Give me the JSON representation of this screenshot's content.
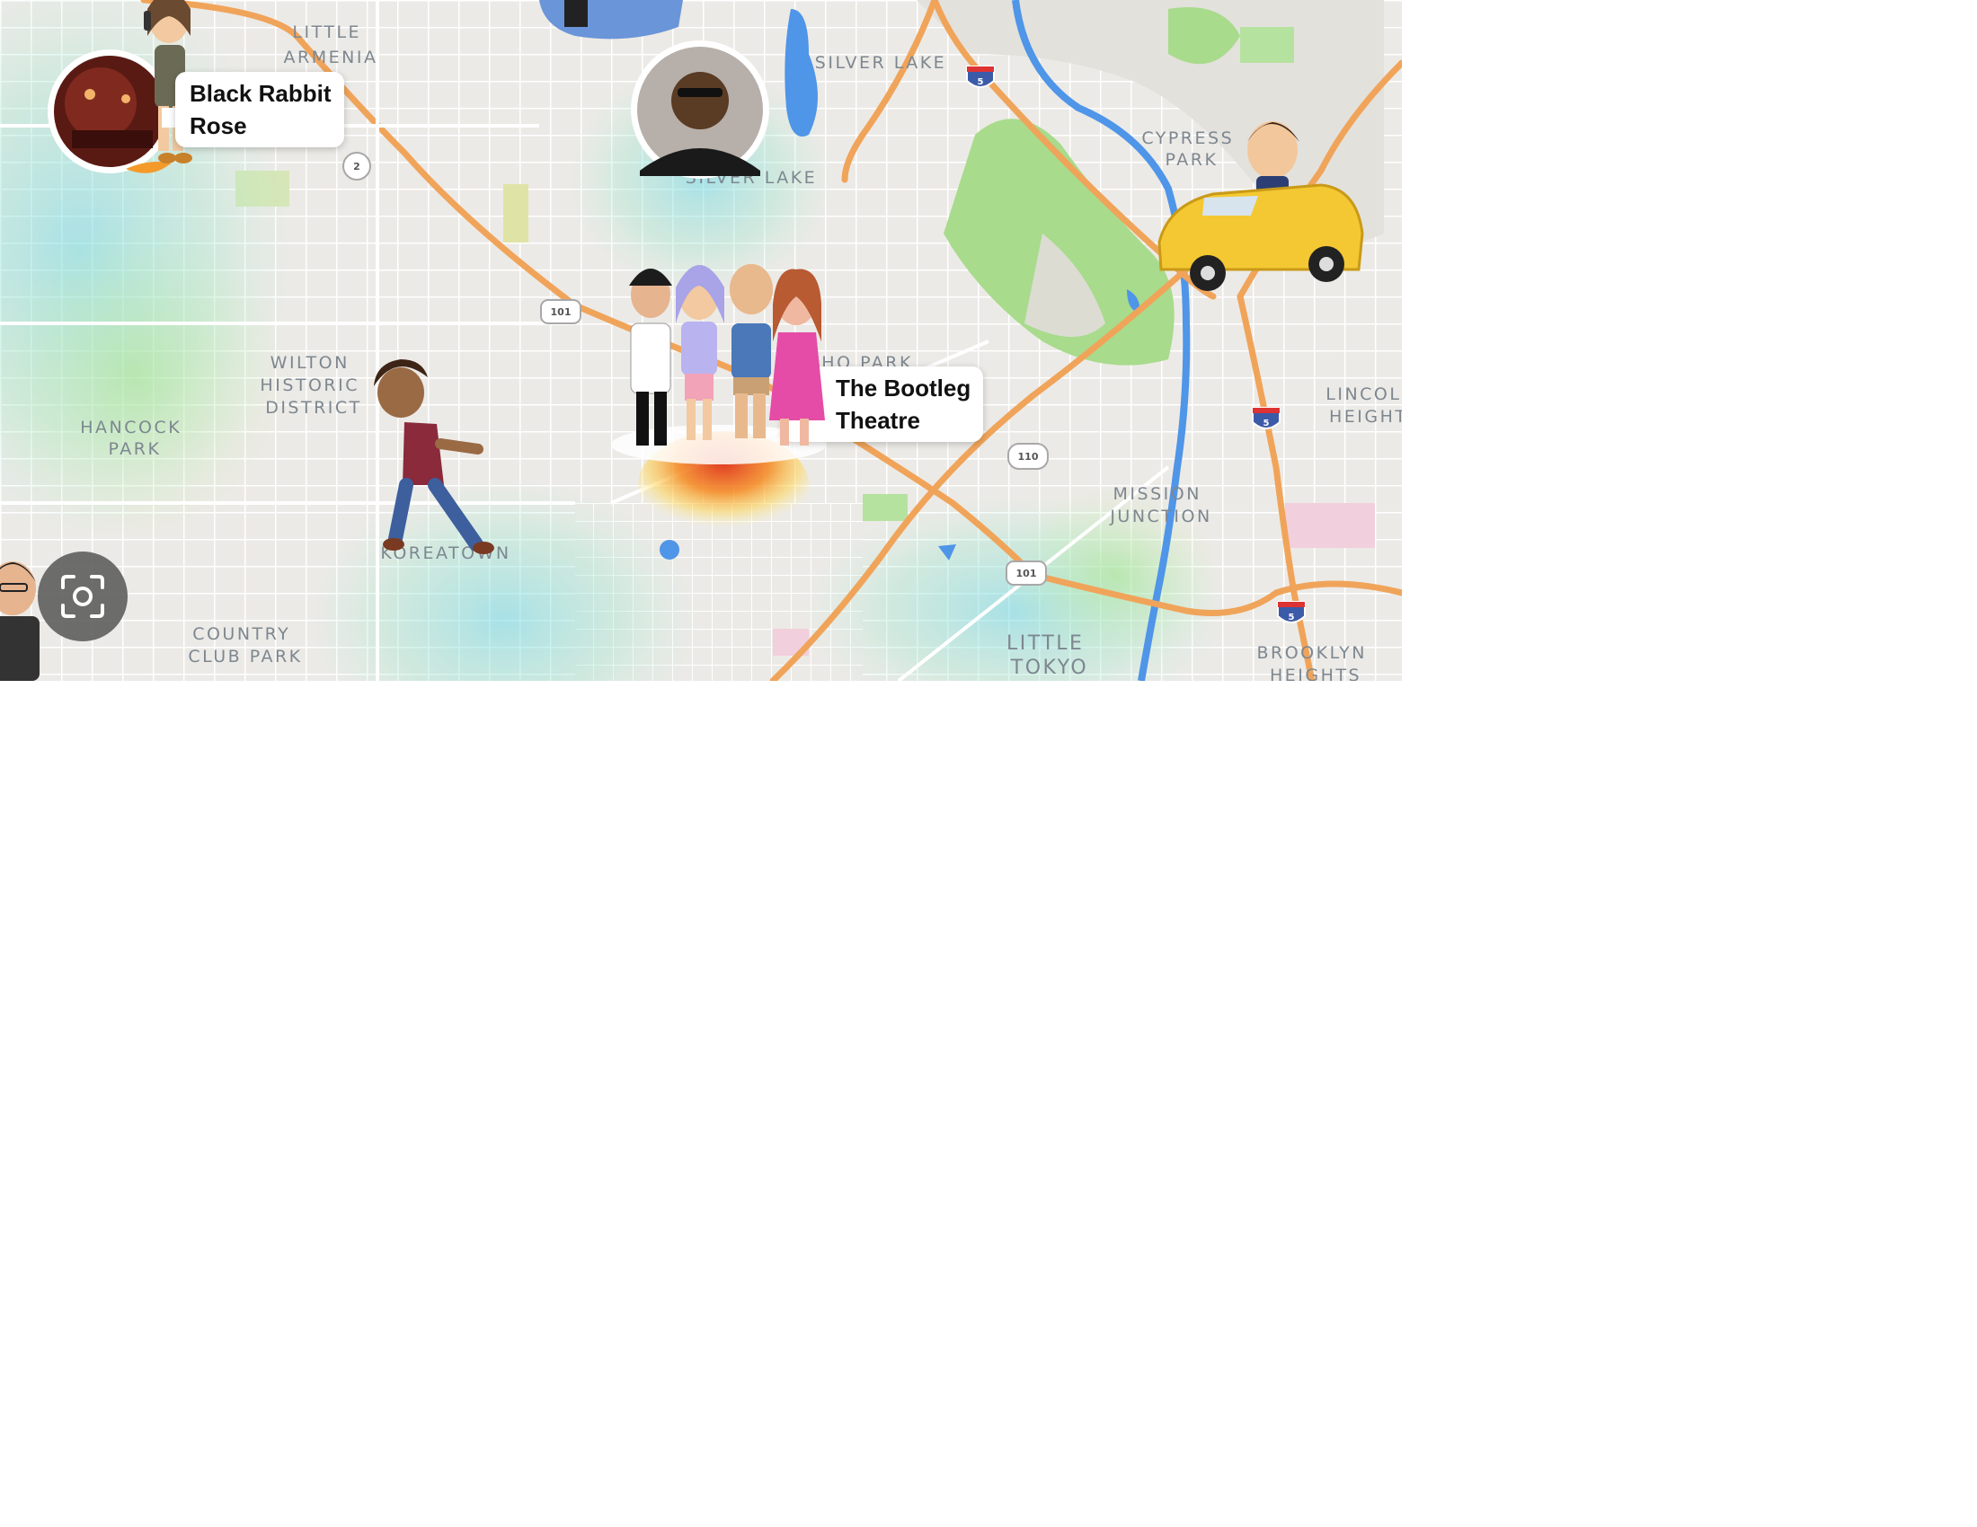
{
  "map": {
    "neighborhoods": [
      {
        "id": "little-armenia",
        "lines": [
          "LITTLE",
          "ARMENIA"
        ]
      },
      {
        "id": "silver-lake",
        "lines": [
          "SILVER LAKE"
        ]
      },
      {
        "id": "silver-lake-reservoir",
        "lines": [
          "SILVER LAKE"
        ]
      },
      {
        "id": "cypress-park",
        "lines": [
          "CYPRESS",
          "PARK"
        ]
      },
      {
        "id": "wilton-historic-district",
        "lines": [
          "WILTON",
          "HISTORIC",
          "DISTRICT"
        ]
      },
      {
        "id": "hancock-park",
        "lines": [
          "HANCOCK",
          "PARK"
        ]
      },
      {
        "id": "koreatown",
        "lines": [
          "KOREATOWN"
        ]
      },
      {
        "id": "country-club-park",
        "lines": [
          "COUNTRY",
          "CLUB PARK"
        ]
      },
      {
        "id": "mission-junction",
        "lines": [
          "MISSION",
          "JUNCTION"
        ]
      },
      {
        "id": "little-tokyo",
        "lines": [
          "LITTLE",
          "TOKYO"
        ]
      },
      {
        "id": "lincoln-heights",
        "lines": [
          "LINCOLN",
          "HEIGHTS"
        ]
      },
      {
        "id": "brooklyn-heights",
        "lines": [
          "BROOKLYN",
          "HEIGHTS"
        ]
      },
      {
        "id": "echo-park",
        "lines": [
          "ECHO PARK"
        ]
      }
    ],
    "route_shields": [
      "2",
      "101",
      "101",
      "110",
      "5",
      "5",
      "5"
    ]
  },
  "places": {
    "black_rabbit_rose": {
      "line1": "Black Rabbit",
      "line2": "Rose"
    },
    "bootleg_theatre": {
      "line1": "The Bootleg",
      "line2": "Theatre"
    }
  },
  "colors": {
    "road": "#f0a45a",
    "water": "#4f95e8",
    "park": "#9fd98a",
    "heat_cool": "#7fdde0",
    "heat_hot": "#f06a1c"
  },
  "icons": {
    "scan_button": "scan-camera-icon"
  }
}
